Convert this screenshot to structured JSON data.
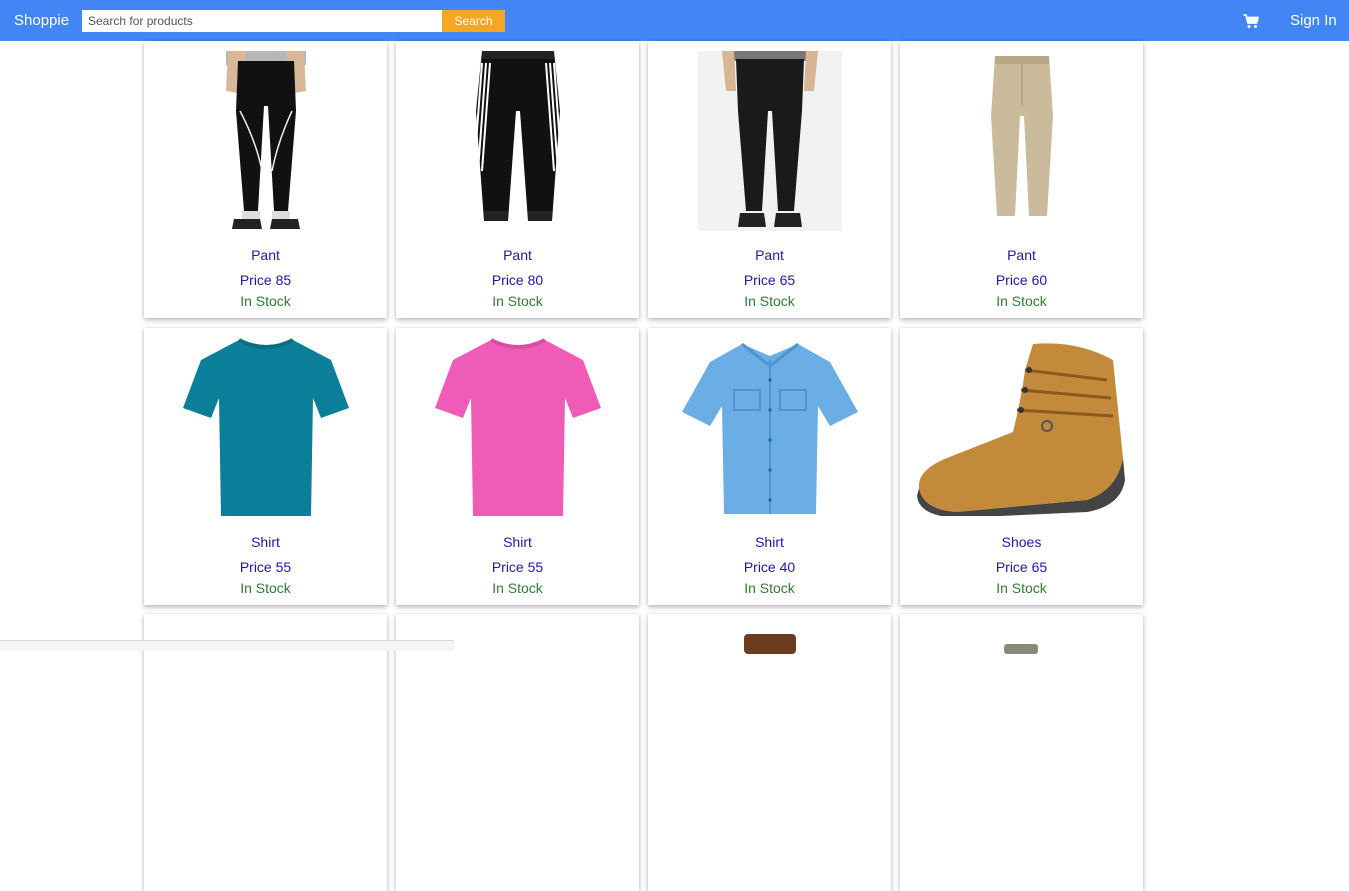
{
  "navbar": {
    "brand": "Shoppie",
    "search_placeholder": "Search for products",
    "search_button": "Search",
    "cart_icon": "shopping-cart-icon",
    "signin_label": "Sign In"
  },
  "products": [
    {
      "name": "Pant",
      "price": "Price 85",
      "stock": "In Stock",
      "image": "jogger-pants-on-model"
    },
    {
      "name": "Pant",
      "price": "Price 80",
      "stock": "In Stock",
      "image": "black-track-pants-with-stripes"
    },
    {
      "name": "Pant",
      "price": "Price 65",
      "stock": "In Stock",
      "image": "black-slim-trousers-on-model"
    },
    {
      "name": "Pant",
      "price": "Price 60",
      "stock": "In Stock",
      "image": "khaki-chino-pants"
    },
    {
      "name": "Shirt",
      "price": "Price 55",
      "stock": "In Stock",
      "image": "teal-t-shirt"
    },
    {
      "name": "Shirt",
      "price": "Price 55",
      "stock": "In Stock",
      "image": "pink-t-shirt"
    },
    {
      "name": "Shirt",
      "price": "Price 40",
      "stock": "In Stock",
      "image": "light-blue-button-up-shirt"
    },
    {
      "name": "Shoes",
      "price": "Price 65",
      "stock": "In Stock",
      "image": "tan-leather-boot"
    }
  ],
  "colors": {
    "navbar": "#4285f4",
    "search_button": "#f5a623",
    "product_text": "#1a1aa6",
    "stock_text": "#2e7d32"
  }
}
